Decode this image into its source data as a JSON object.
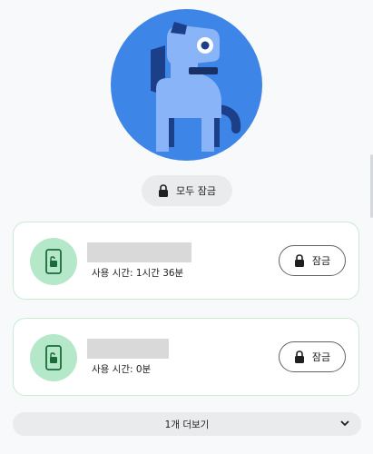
{
  "lock_all": {
    "label": "모두 잠금",
    "icon": "lock-icon"
  },
  "apps": [
    {
      "usage": "사용 시간: 1시간 36분",
      "lock_label": "잠금",
      "icon": "phone-unlock-icon"
    },
    {
      "usage": "사용 시간: 0분",
      "lock_label": "잠금",
      "icon": "phone-unlock-icon"
    }
  ],
  "more": {
    "label": "1개 더보기",
    "icon": "chevron-down-icon"
  },
  "colors": {
    "avatar_bg": "#3d85e6",
    "card_border": "#c8ebd1",
    "app_icon_bg": "#b5e8c9",
    "button_bg": "#e9ebed"
  }
}
